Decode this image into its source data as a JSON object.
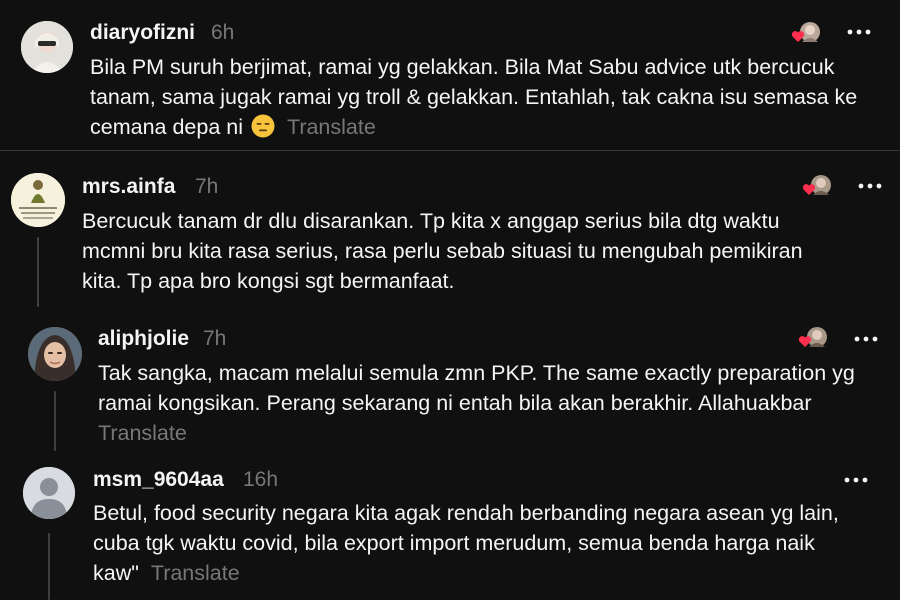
{
  "comments": [
    {
      "username": "diaryofizni",
      "time": "6h",
      "lines": [
        "Bila PM suruh berjimat, ramai yg gelakkan. Bila Mat Sabu advice utk bercucuk",
        "tanam, sama jugak ramai yg troll & gelakkan. Entahlah, tak cakna isu semasa ke",
        "cemana depa ni"
      ],
      "translate": "Translate",
      "emoji_icon": "expressionless-face-emoji"
    },
    {
      "username": "mrs.ainfa",
      "time": "7h",
      "lines": [
        "Bercucuk tanam dr dlu disarankan. Tp kita x anggap serius bila dtg waktu",
        "mcmni bru kita rasa serius, rasa perlu sebab situasi tu mengubah pemikiran",
        "kita. Tp apa bro kongsi sgt bermanfaat."
      ]
    },
    {
      "username": "aliphjolie",
      "time": "7h",
      "lines": [
        "Tak sangka, macam melalui semula zmn PKP. The same exactly preparation yg",
        "ramai kongsikan. Perang sekarang ni entah bila akan berakhir. Allahuakbar"
      ],
      "translate": "Translate"
    },
    {
      "username": "msm_9604aa",
      "time": "16h",
      "lines": [
        "Betul, food security negara kita agak rendah berbanding negara asean yg lain,",
        "cuba tgk waktu covid, bila export import merudum, semua benda harga naik",
        "kaw\""
      ],
      "translate": "Translate"
    }
  ],
  "colors": {
    "background": "#101010",
    "text": "#f3f5f7",
    "secondary": "#777777",
    "like_heart": "#ff2f4f"
  }
}
